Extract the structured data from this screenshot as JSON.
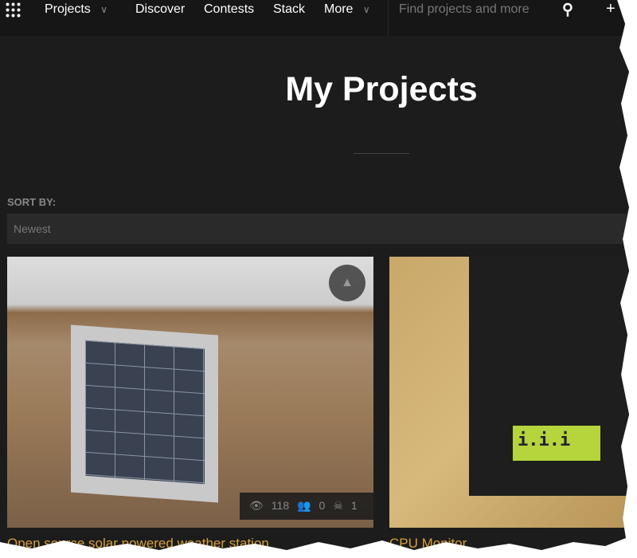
{
  "nav": {
    "projects": "Projects",
    "discover": "Discover",
    "contests": "Contests",
    "stack": "Stack",
    "more": "More",
    "search_placeholder": "Find projects and more",
    "search_icon": "search-icon",
    "add_icon": "plus-icon"
  },
  "header": {
    "title": "My Projects"
  },
  "sort": {
    "label": "SORT BY:",
    "value": "Newest"
  },
  "projects": [
    {
      "title": "Open source solar powered weather station",
      "views": "118",
      "followers": "0",
      "skulls": "1"
    },
    {
      "title": "CPU Monitor",
      "lcd": "i.i.i"
    }
  ],
  "colors": {
    "accent": "#d6a03a",
    "background": "#1c1c1c"
  }
}
